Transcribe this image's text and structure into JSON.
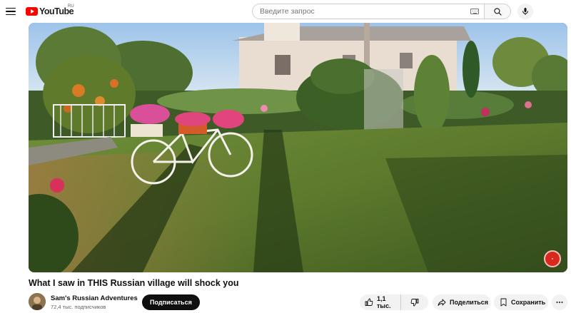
{
  "header": {
    "logo_text": "YouTube",
    "country_code": "RU",
    "search_placeholder": "Введите запрос",
    "icons": [
      "menu-icon",
      "keyboard-icon",
      "search-icon",
      "mic-icon"
    ]
  },
  "player": {
    "scene": "video-frame-garden-bicycle",
    "badge_icon": "channel-watermark-icon"
  },
  "video": {
    "title": "What I saw in THIS Russian village will shock you"
  },
  "channel": {
    "name": "Sam's Russian Adventures",
    "subscribers": "72,4 тыс. подписчиков",
    "subscribe_label": "Подписаться"
  },
  "actions": {
    "likes": "1,1 тыс.",
    "share_label": "Поделиться",
    "save_label": "Сохранить",
    "icons": [
      "thumb-up-icon",
      "thumb-down-icon",
      "share-icon",
      "bookmark-icon",
      "more-icon"
    ]
  },
  "colors": {
    "brand_red": "#ff0000",
    "subscribe_bg": "#0f0f0f",
    "pill_bg": "#f2f2f2"
  }
}
